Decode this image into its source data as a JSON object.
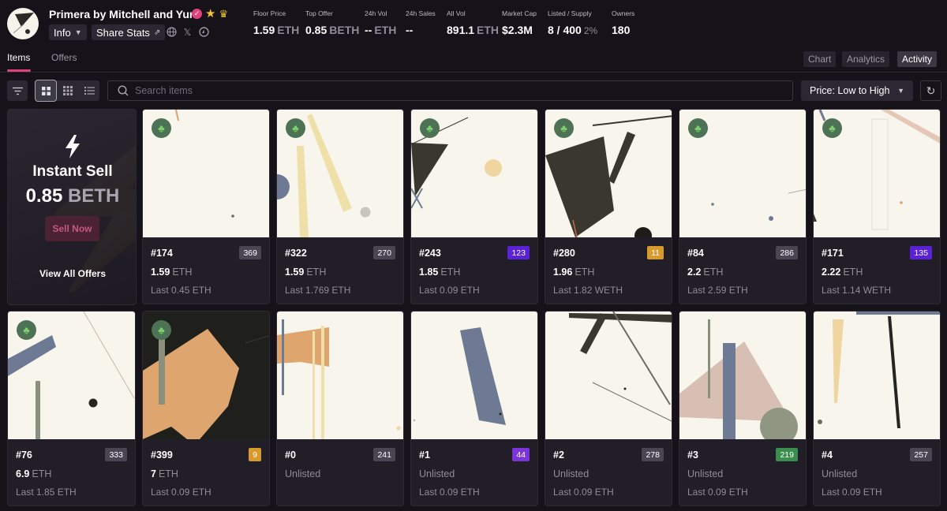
{
  "collection": {
    "name": "Primera by Mitchell and Yun",
    "info_label": "Info",
    "share_label": "Share Stats"
  },
  "stats": [
    {
      "label": "Floor Price",
      "value": "1.59",
      "unit": "ETH"
    },
    {
      "label": "Top Offer",
      "value": "0.85",
      "unit": "BETH"
    },
    {
      "label": "24h Vol",
      "value": "--",
      "unit": "ETH"
    },
    {
      "label": "24h Sales",
      "value": "--",
      "unit": ""
    },
    {
      "label": "All Vol",
      "value": "891.1",
      "unit": "ETH"
    },
    {
      "label": "Market Cap",
      "value": "$2.3M",
      "unit": ""
    },
    {
      "label": "Listed / Supply",
      "value": "8 / 400",
      "unit": "2%"
    },
    {
      "label": "Owners",
      "value": "180",
      "unit": ""
    }
  ],
  "tabs": {
    "items": "Items",
    "offers": "Offers"
  },
  "right_tabs": {
    "chart": "Chart",
    "analytics": "Analytics",
    "activity": "Activity"
  },
  "search": {
    "placeholder": "Search items"
  },
  "sort": {
    "label": "Price: Low to High"
  },
  "instant_sell": {
    "title": "Instant Sell",
    "amount": "0.85",
    "unit": "BETH",
    "button": "Sell Now",
    "view_all": "View All Offers"
  },
  "colors": {
    "accent": "#e0427f",
    "rank_grey": "#4a4453",
    "rank_purple": "#5b21d6",
    "rank_violet": "#7c33d9",
    "rank_gold": "#d89a2a",
    "rank_green": "#3a8f4e"
  },
  "items": [
    {
      "id": "#174",
      "rank": "369",
      "rank_color": "#4a4453",
      "price": "1.59",
      "unit": "ETH",
      "last": "Last 0.45 ETH"
    },
    {
      "id": "#322",
      "rank": "270",
      "rank_color": "#4a4453",
      "price": "1.59",
      "unit": "ETH",
      "last": "Last 1.769 ETH"
    },
    {
      "id": "#243",
      "rank": "123",
      "rank_color": "#5b21d6",
      "price": "1.85",
      "unit": "ETH",
      "last": "Last 0.09 ETH"
    },
    {
      "id": "#280",
      "rank": "11",
      "rank_color": "#d89a2a",
      "price": "1.96",
      "unit": "ETH",
      "last": "Last 1.82 WETH"
    },
    {
      "id": "#84",
      "rank": "286",
      "rank_color": "#4a4453",
      "price": "2.2",
      "unit": "ETH",
      "last": "Last 2.59 ETH"
    },
    {
      "id": "#171",
      "rank": "135",
      "rank_color": "#5b21d6",
      "price": "2.22",
      "unit": "ETH",
      "last": "Last 1.14 WETH"
    },
    {
      "id": "#76",
      "rank": "333",
      "rank_color": "#4a4453",
      "price": "6.9",
      "unit": "ETH",
      "last": "Last 1.85 ETH"
    },
    {
      "id": "#399",
      "rank": "9",
      "rank_color": "#d89a2a",
      "price": "7",
      "unit": "ETH",
      "last": "Last 0.09 ETH"
    },
    {
      "id": "#0",
      "rank": "241",
      "rank_color": "#4a4453",
      "price": "Unlisted",
      "unit": "",
      "last": ""
    },
    {
      "id": "#1",
      "rank": "44",
      "rank_color": "#7c33d9",
      "price": "Unlisted",
      "unit": "",
      "last": "Last 0.09 ETH"
    },
    {
      "id": "#2",
      "rank": "278",
      "rank_color": "#4a4453",
      "price": "Unlisted",
      "unit": "",
      "last": "Last 0.09 ETH"
    },
    {
      "id": "#3",
      "rank": "219",
      "rank_color": "#3a8f4e",
      "price": "Unlisted",
      "unit": "",
      "last": "Last 0.09 ETH"
    },
    {
      "id": "#4",
      "rank": "257",
      "rank_color": "#4a4453",
      "price": "Unlisted",
      "unit": "",
      "last": "Last 0.09 ETH"
    }
  ]
}
